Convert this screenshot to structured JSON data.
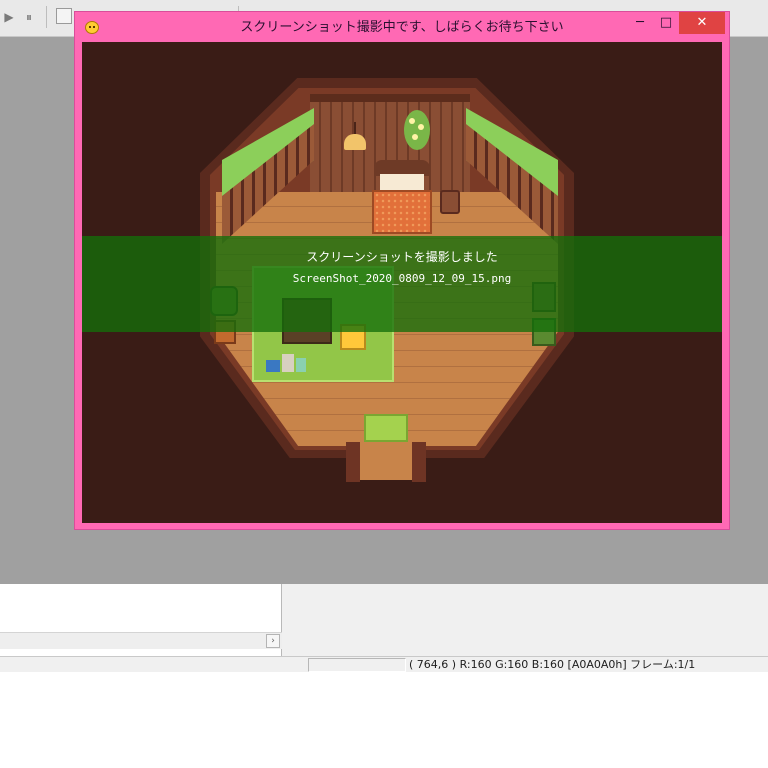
{
  "game_window": {
    "title": "スクリーンショット撮影中です、しばらくお待ち下さい",
    "controls": {
      "minimize": "─",
      "maximize": "□",
      "close": "✕"
    },
    "icon": "smiley-app-icon",
    "frame_color": "#ff69b4"
  },
  "notification": {
    "message": "スクリーンショットを撮影しました",
    "filename": "ScreenShot_2020_0809_12_09_15.png",
    "banner_color": "#146e0a"
  },
  "toolbar": {
    "play_icon": "▶",
    "pause_icon": "⏸"
  },
  "statusbar": {
    "pixel_info": "( 764,6 ) R:160 G:160 B:160  [A0A0A0h]  フレーム:1/1"
  },
  "scrollbar": {
    "arrow": "›"
  }
}
